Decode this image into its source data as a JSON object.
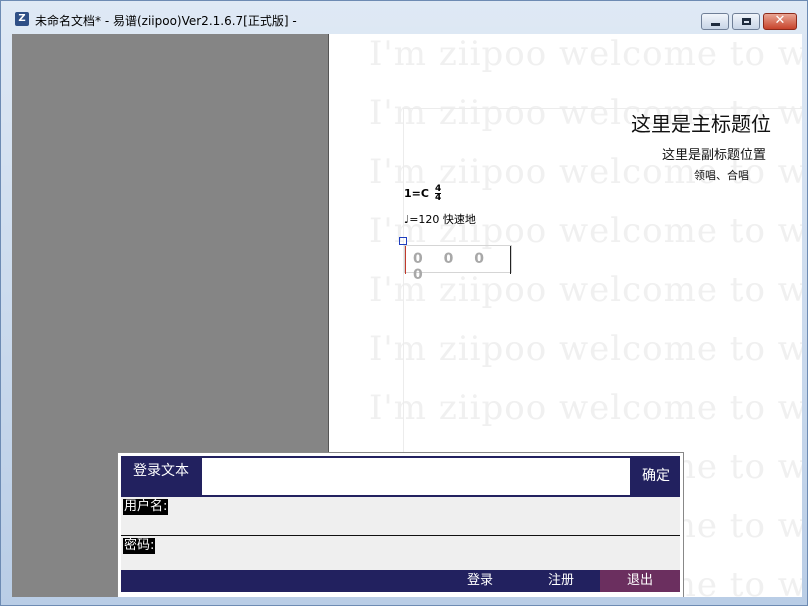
{
  "window": {
    "app_icon_letter": "Z",
    "title": "未命名文档* - 易谱(ziipoo)Ver2.1.6.7[正式版]  -",
    "close_glyph": "✕"
  },
  "score": {
    "watermark_text": "I'm ziipoo  welcome to www",
    "main_title": "这里是主标题位",
    "sub_title": "这里是副标题位置",
    "singers": "领唱、合唱",
    "key": "1=C",
    "time_numerator": "4",
    "time_denominator": "4",
    "tempo": "♩=120  快速地",
    "notes": "0 0 0 0"
  },
  "dialog": {
    "title": "登录文本",
    "text_value": "",
    "ok_label": "确定",
    "username_label": "用户名:",
    "username_value": "",
    "password_label": "密码:",
    "password_value": "",
    "login_label": "登录",
    "register_label": "注册",
    "exit_label": "退出"
  },
  "colors": {
    "dialog_bar": "#22215f",
    "exit_button": "#6b2f5f",
    "side_pane": "#858585"
  }
}
